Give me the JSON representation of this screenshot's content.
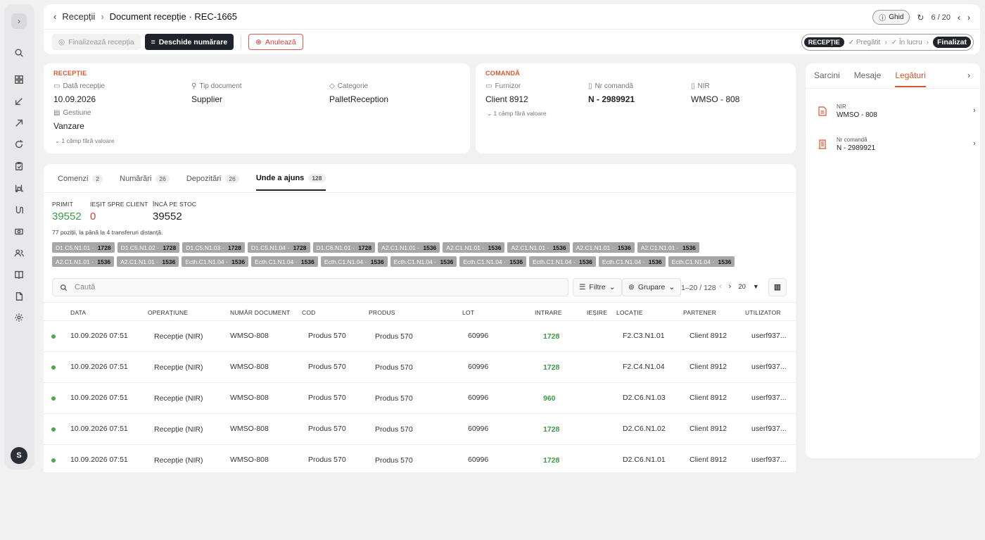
{
  "rail": {
    "icons": [
      "chevron-right-icon",
      "search-icon",
      "grid-icon",
      "arrow-in-icon",
      "arrow-out-icon",
      "refresh-icon",
      "clipboard-icon",
      "forklift-icon",
      "route-icon",
      "money-icon",
      "users-icon",
      "book-icon",
      "document-icon",
      "gear-icon"
    ],
    "avatar": "S"
  },
  "header": {
    "breadcrumb_root": "Recepții",
    "breadcrumb_current": "Document recepție · REC-1665",
    "ghid": "Ghid",
    "pager": "6 / 20"
  },
  "actions": {
    "finalize": "Finalizează recepția",
    "open_count": "Deschide numărare",
    "cancel": "Anulează"
  },
  "status": {
    "badge": "RECEPȚIE",
    "step1": "✓ Pregătit",
    "step2": "✓ În lucru",
    "final": "Finalizat"
  },
  "receptie": {
    "title": "RECEPȚIE",
    "date_label": "Dată recepție",
    "date_value": "10.09.2026",
    "type_label": "Tip document",
    "type_value": "Supplier",
    "cat_label": "Categorie",
    "cat_value": "PalletReception",
    "gest_label": "Gestiune",
    "gest_value": "Vanzare",
    "more": "1 câmp fără valoare"
  },
  "comanda": {
    "title": "COMANDĂ",
    "sup_label": "Furnizor",
    "sup_value": "Client 8912",
    "nr_label": "Nr comandă",
    "nr_value": "N - 2989921",
    "nir_label": "NIR",
    "nir_value": "WMSO - 808",
    "more": "1 câmp fără valoare"
  },
  "tabs": [
    {
      "label": "Comenzi",
      "count": "2"
    },
    {
      "label": "Numărări",
      "count": "26"
    },
    {
      "label": "Depozitări",
      "count": "26"
    },
    {
      "label": "Unde a ajuns",
      "count": "128"
    }
  ],
  "kpis": {
    "primit_label": "PRIMIT",
    "primit_value": "39552",
    "iesit_label": "IEȘIT SPRE CLIENT",
    "iesit_value": "0",
    "stoc_label": "ÎNCĂ PE STOC",
    "stoc_value": "39552"
  },
  "note": "77 poziții, la până la 4 transferuri distanță.",
  "chips": [
    {
      "loc": "D1.C5.N1.01",
      "qty": "1728"
    },
    {
      "loc": "D1.C5.N1.02",
      "qty": "1728"
    },
    {
      "loc": "D1.C5.N1.03",
      "qty": "1728"
    },
    {
      "loc": "D1.C5.N1.04",
      "qty": "1728"
    },
    {
      "loc": "D1.C6.N1.01",
      "qty": "1728"
    },
    {
      "loc": "A2.C1.N1.01",
      "qty": "1536"
    },
    {
      "loc": "A2.C1.N1.01",
      "qty": "1536"
    },
    {
      "loc": "A2.C1.N1.01",
      "qty": "1536"
    },
    {
      "loc": "A2.C1.N1.01",
      "qty": "1536"
    },
    {
      "loc": "A2.C1.N1.01",
      "qty": "1536"
    },
    {
      "loc": "A2.C1.N1.01",
      "qty": "1536"
    },
    {
      "loc": "A2.C1.N1.01",
      "qty": "1536"
    },
    {
      "loc": "Ecth.C1.N1.04",
      "qty": "1536"
    },
    {
      "loc": "Ecth.C1.N1.04",
      "qty": "1536"
    },
    {
      "loc": "Ecth.C1.N1.04",
      "qty": "1536"
    },
    {
      "loc": "Ecth.C1.N1.04",
      "qty": "1536"
    },
    {
      "loc": "Ecth.C1.N1.04",
      "qty": "1536"
    },
    {
      "loc": "Ecth.C1.N1.04",
      "qty": "1536"
    },
    {
      "loc": "Ecth.C1.N1.04",
      "qty": "1536"
    },
    {
      "loc": "Ecth.C1.N1.04",
      "qty": "1536"
    }
  ],
  "toolbar": {
    "search_placeholder": "Caută",
    "filters": "Filtre",
    "group": "Grupare",
    "range": "1–20 / 128",
    "page_size": "20"
  },
  "columns": [
    "DATA",
    "OPERAȚIUNE",
    "NUMĂR DOCUMENT",
    "COD",
    "PRODUS",
    "LOT",
    "INTRARE",
    "IEȘIRE",
    "LOCAȚIE",
    "PARTENER",
    "UTILIZATOR"
  ],
  "rows": [
    {
      "date": "10.09.2026 07:51",
      "op": "Recepție (NIR)",
      "doc": "WMSO-808",
      "cod": "Produs 570",
      "prod": "Produs 570",
      "lot": "60996",
      "in": "1728",
      "loc": "F2.C3.N1.01",
      "partner": "Client 8912",
      "user": "userf937..."
    },
    {
      "date": "10.09.2026 07:51",
      "op": "Recepție (NIR)",
      "doc": "WMSO-808",
      "cod": "Produs 570",
      "prod": "Produs 570",
      "lot": "60996",
      "in": "1728",
      "loc": "F2.C4.N1.04",
      "partner": "Client 8912",
      "user": "userf937..."
    },
    {
      "date": "10.09.2026 07:51",
      "op": "Recepție (NIR)",
      "doc": "WMSO-808",
      "cod": "Produs 570",
      "prod": "Produs 570",
      "lot": "60996",
      "in": "960",
      "loc": "D2.C6.N1.03",
      "partner": "Client 8912",
      "user": "userf937..."
    },
    {
      "date": "10.09.2026 07:51",
      "op": "Recepție (NIR)",
      "doc": "WMSO-808",
      "cod": "Produs 570",
      "prod": "Produs 570",
      "lot": "60996",
      "in": "1728",
      "loc": "D2.C6.N1.02",
      "partner": "Client 8912",
      "user": "userf937..."
    },
    {
      "date": "10.09.2026 07:51",
      "op": "Recepție (NIR)",
      "doc": "WMSO-808",
      "cod": "Produs 570",
      "prod": "Produs 570",
      "lot": "60996",
      "in": "1728",
      "loc": "D2.C6.N1.01",
      "partner": "Client 8912",
      "user": "userf937..."
    }
  ],
  "right_panel": {
    "tabs": [
      "Sarcini",
      "Mesaje",
      "Legături"
    ],
    "links": [
      {
        "label": "NIR",
        "value": "WMSO - 808"
      },
      {
        "label": "Nr comandă",
        "value": "N - 2989921"
      }
    ]
  },
  "colors": {
    "accent": "#d9552f",
    "dark": "#1f232a",
    "green": "#3c9a44",
    "red": "#d43d3d"
  }
}
